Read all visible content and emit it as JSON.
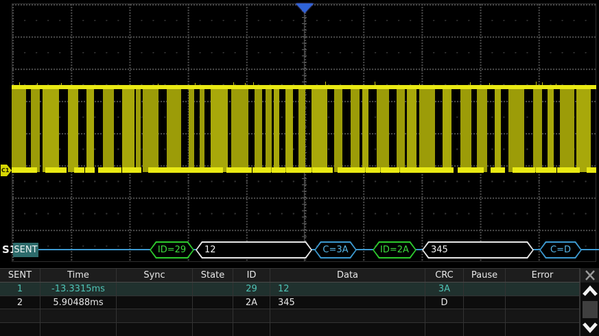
{
  "channel": {
    "label": "C1"
  },
  "decode": {
    "bus_label": "S1",
    "protocol_badge": "SENT",
    "frames": [
      {
        "label": "ID=29",
        "kind": "id"
      },
      {
        "label": "12",
        "kind": "data"
      },
      {
        "label": "C=3A",
        "kind": "crc"
      },
      {
        "label": "ID=2A",
        "kind": "id"
      },
      {
        "label": "345",
        "kind": "data"
      },
      {
        "label": "C=D",
        "kind": "crc"
      }
    ]
  },
  "table": {
    "columns": [
      "SENT",
      "Time",
      "Sync",
      "State",
      "ID",
      "Data",
      "CRC",
      "Pause",
      "Error"
    ],
    "rows": [
      {
        "selected": true,
        "cells": [
          "1",
          "-13.3315ms",
          "",
          "",
          "29",
          "12",
          "3A",
          "",
          ""
        ]
      },
      {
        "selected": false,
        "cells": [
          "2",
          "5.90488ms",
          "",
          "",
          "2A",
          "345",
          "D",
          "",
          ""
        ]
      },
      {
        "selected": false,
        "cells": [
          "",
          "",
          "",
          "",
          "",
          "",
          "",
          "",
          ""
        ]
      },
      {
        "selected": false,
        "cells": [
          "",
          "",
          "",
          "",
          "",
          "",
          "",
          "",
          ""
        ]
      }
    ]
  },
  "colors": {
    "channel_yellow": "#a6a609",
    "channel_yellow_bright": "#e9e913",
    "decode_blue": "#3d9ad1",
    "frame_green": "#2ecc2e",
    "selected_teal": "#4fc3b5",
    "trigger_blue": "#2f63d8",
    "badge_teal": "#2d6b6b"
  }
}
